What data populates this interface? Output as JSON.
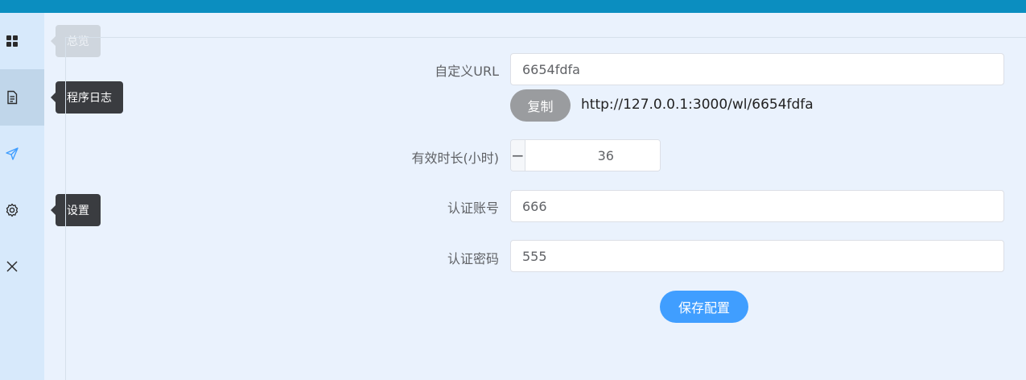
{
  "sidebar": {
    "items": [
      {
        "icon": "grid-icon",
        "tooltip": "总览"
      },
      {
        "icon": "document-icon",
        "tooltip": "程序日志"
      },
      {
        "icon": "send-icon",
        "tooltip": ""
      },
      {
        "icon": "gear-icon",
        "tooltip": "设置"
      },
      {
        "icon": "close-icon",
        "tooltip": ""
      }
    ],
    "active_index": 1
  },
  "form": {
    "custom_url": {
      "label": "自定义URL",
      "value": "6654fdfa"
    },
    "copy_button": "复制",
    "full_url": "http://127.0.0.1:3000/wl/6654fdfa",
    "duration": {
      "label": "有效时长(小时)",
      "value": "36",
      "minus": "−",
      "plus": "+"
    },
    "auth_account": {
      "label": "认证账号",
      "value": "666"
    },
    "auth_password": {
      "label": "认证密码",
      "value": "555"
    },
    "save_button": "保存配置"
  },
  "colors": {
    "topbar": "#0b8ec0",
    "sidebar": "#d7e9fb",
    "primary": "#409eff",
    "copy_button": "#9a9c9f"
  }
}
